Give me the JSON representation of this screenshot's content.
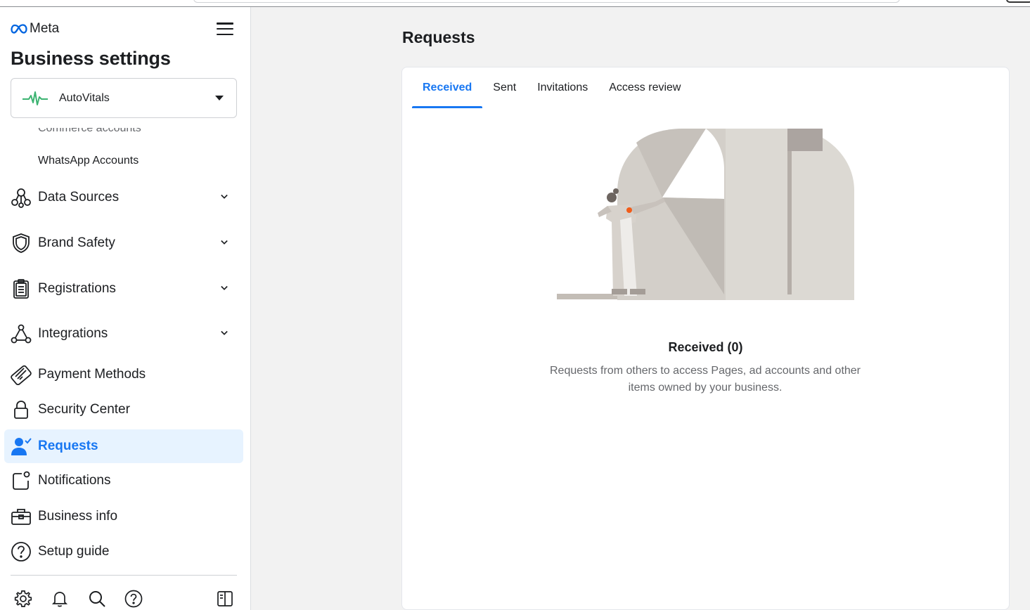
{
  "brand": {
    "name": "Meta",
    "logo_icon": "meta-infinity-logo"
  },
  "sidebar": {
    "heading": "Business settings",
    "account": {
      "name": "AutoVitals",
      "icon": "heartbeat-icon",
      "accent": "#3cb371"
    },
    "partial_item": "Commerce accounts",
    "sub_items": [
      {
        "label": "WhatsApp Accounts"
      }
    ],
    "items": [
      {
        "label": "Data Sources",
        "icon": "data-sources-icon",
        "expandable": true
      },
      {
        "label": "Brand Safety",
        "icon": "shield-icon",
        "expandable": true
      },
      {
        "label": "Registrations",
        "icon": "clipboard-icon",
        "expandable": true
      },
      {
        "label": "Integrations",
        "icon": "integrations-icon",
        "expandable": true
      },
      {
        "label": "Payment Methods",
        "icon": "credit-card-icon",
        "expandable": false
      },
      {
        "label": "Security Center",
        "icon": "lock-icon",
        "expandable": false
      },
      {
        "label": "Requests",
        "icon": "person-check-icon",
        "expandable": false,
        "active": true
      },
      {
        "label": "Notifications",
        "icon": "notification-icon",
        "expandable": false
      },
      {
        "label": "Business info",
        "icon": "briefcase-icon",
        "expandable": false
      },
      {
        "label": "Setup guide",
        "icon": "question-circle-icon",
        "expandable": false
      }
    ],
    "footer_icons": [
      "gear-icon",
      "bell-icon",
      "search-icon",
      "help-icon",
      "panel-toggle-icon"
    ]
  },
  "main": {
    "title": "Requests",
    "tabs": [
      {
        "label": "Received",
        "active": true
      },
      {
        "label": "Sent",
        "active": false
      },
      {
        "label": "Invitations",
        "active": false
      },
      {
        "label": "Access review",
        "active": false
      }
    ],
    "empty_state": {
      "title": "Received (0)",
      "description": "Requests from others to access Pages, ad accounts and other items owned by your business."
    }
  },
  "colors": {
    "accent": "#1877f2",
    "active_bg": "#e7f3ff",
    "text": "#1c1e21",
    "muted": "#65676b"
  }
}
